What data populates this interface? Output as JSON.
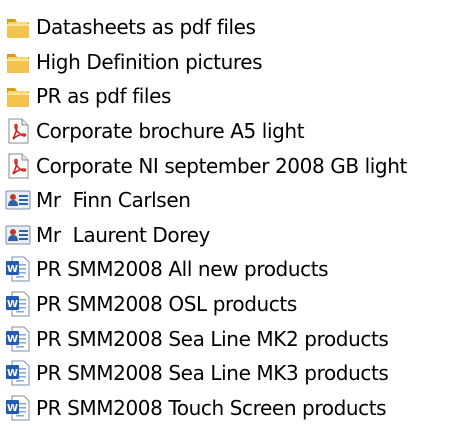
{
  "colors": {
    "folder": "#f2c34e",
    "folder_dark": "#d99a1c",
    "pdf_red": "#d42020",
    "contact_blue": "#2f5fa8",
    "word_blue": "#1f5bb5"
  },
  "items": [
    {
      "label": "Datasheets as pdf files",
      "icon": "folder-icon"
    },
    {
      "label": "High Definition pictures",
      "icon": "folder-icon"
    },
    {
      "label": "PR as pdf files",
      "icon": "folder-icon"
    },
    {
      "label": "Corporate brochure A5 light",
      "icon": "pdf-icon"
    },
    {
      "label": "Corporate NI september 2008 GB light",
      "icon": "pdf-icon"
    },
    {
      "label": "Mr  Finn Carlsen",
      "icon": "contact-card-icon"
    },
    {
      "label": "Mr  Laurent Dorey",
      "icon": "contact-card-icon"
    },
    {
      "label": "PR SMM2008 All new products",
      "icon": "word-document-icon"
    },
    {
      "label": "PR SMM2008 OSL products",
      "icon": "word-document-icon"
    },
    {
      "label": "PR SMM2008 Sea Line MK2 products",
      "icon": "word-document-icon"
    },
    {
      "label": "PR SMM2008 Sea Line MK3 products",
      "icon": "word-document-icon"
    },
    {
      "label": "PR SMM2008 Touch Screen products",
      "icon": "word-document-icon"
    }
  ]
}
